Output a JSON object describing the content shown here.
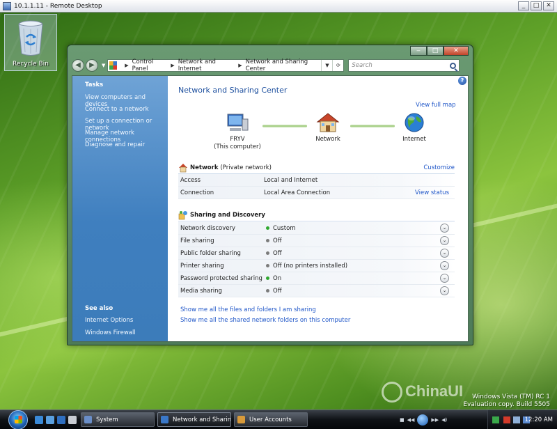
{
  "remote_desktop": {
    "title": "10.1.1.11 - Remote Desktop",
    "min": "_",
    "max": "□",
    "close": "✕"
  },
  "desktop": {
    "recycle_bin": "Recycle Bin",
    "watermark": "ChinaUI",
    "version_line1": "Windows Vista (TM) RC 1",
    "version_line2": "Evaluation copy. Build 5505"
  },
  "window": {
    "controls": {
      "minimize": "‒",
      "maximize": "□",
      "close": "✕"
    },
    "nav": {
      "back": "◀",
      "forward": "▶",
      "dropdown": "▼"
    },
    "address": {
      "crumbs": [
        "Control Panel",
        "Network and Internet",
        "Network and Sharing Center"
      ],
      "separator": "▶",
      "dropdown": "▼",
      "refresh": "⟳"
    },
    "search_placeholder": "Search",
    "help": "?"
  },
  "sidebar": {
    "tasks_heading": "Tasks",
    "tasks": [
      "View computers and devices",
      "Connect to a network",
      "Set up a connection or network",
      "Manage network connections",
      "Diagnose and repair"
    ],
    "see_also_heading": "See also",
    "see_also": [
      "Internet Options",
      "Windows Firewall"
    ]
  },
  "main": {
    "title": "Network and Sharing Center",
    "view_full_map": "View full map",
    "map": {
      "computer_name": "FRYV",
      "computer_sub": "(This computer)",
      "network": "Network",
      "internet": "Internet"
    },
    "network_section": {
      "title": "Network",
      "subtitle": "(Private network)",
      "customize": "Customize",
      "rows": [
        {
          "label": "Access",
          "value": "Local and Internet",
          "link": ""
        },
        {
          "label": "Connection",
          "value": "Local Area Connection",
          "link": "View status"
        }
      ]
    },
    "sharing_section": {
      "title": "Sharing and Discovery",
      "expand": "⌄",
      "rows": [
        {
          "label": "Network discovery",
          "value": "Custom",
          "status": "green"
        },
        {
          "label": "File sharing",
          "value": "Off",
          "status": "gray"
        },
        {
          "label": "Public folder sharing",
          "value": "Off",
          "status": "gray"
        },
        {
          "label": "Printer sharing",
          "value": "Off (no printers installed)",
          "status": "gray"
        },
        {
          "label": "Password protected sharing",
          "value": "On",
          "status": "green"
        },
        {
          "label": "Media sharing",
          "value": "Off",
          "status": "gray"
        }
      ]
    },
    "bottom_links": [
      "Show me all the files and folders I am sharing",
      "Show me all the shared network folders on this computer"
    ]
  },
  "taskbar": {
    "buttons": [
      "System",
      "Network and Sharin...",
      "User Accounts"
    ],
    "media": {
      "prev": "◀◀",
      "stop": "■",
      "next": "▶▶",
      "volume": "◀)"
    },
    "clock": "12:20 AM"
  },
  "colors": {
    "accent_blue": "#1f56c8",
    "status_green": "#2fa82f",
    "status_gray": "#7b7b7b",
    "sidebar_blue": "#3f7fbf"
  }
}
